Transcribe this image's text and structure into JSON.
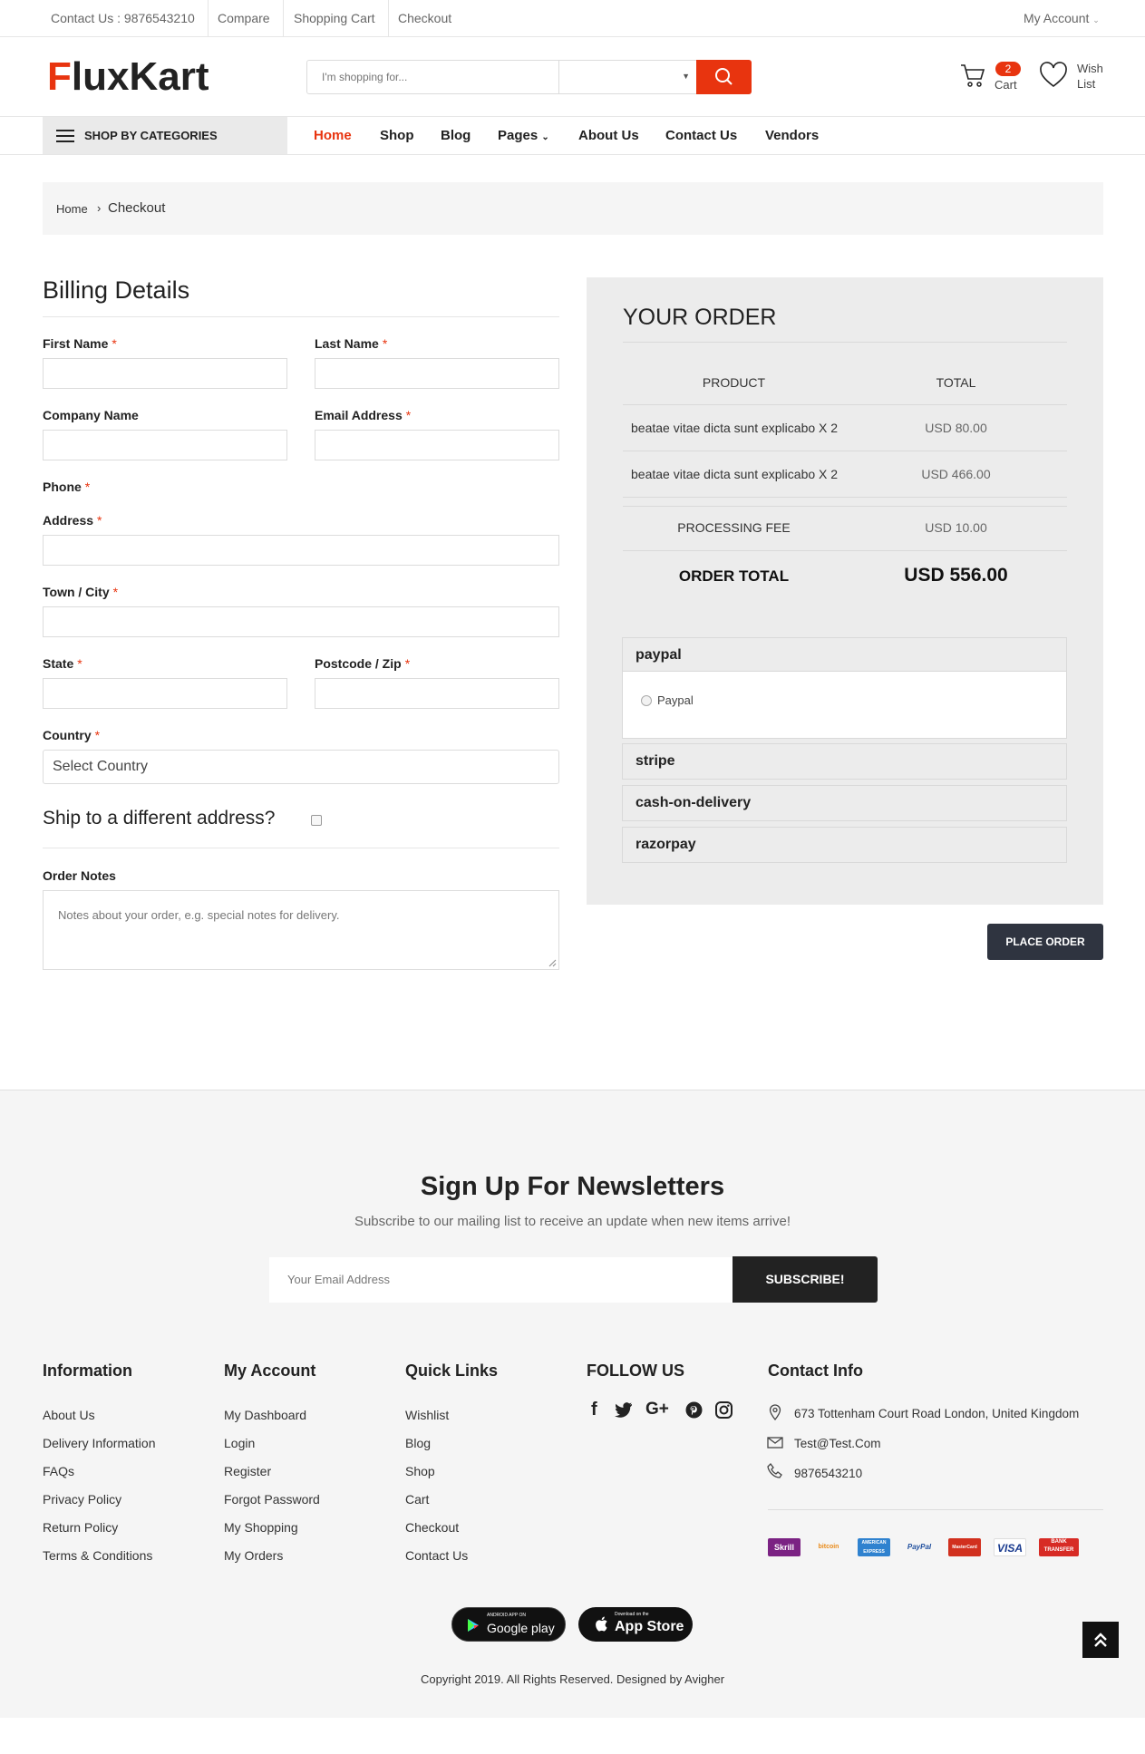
{
  "topbar": {
    "contact": "Contact Us : 9876543210",
    "compare": "Compare",
    "cart": "Shopping Cart",
    "checkout": "Checkout",
    "account": "My Account"
  },
  "header": {
    "logo_a": "F",
    "logo_b": "luxKart",
    "search_placeholder": "I'm shopping for...",
    "cart_count": "2",
    "cart_label": "Cart",
    "wish_label_1": "Wish",
    "wish_label_2": "List"
  },
  "nav": {
    "categories": "SHOP BY CATEGORIES",
    "links": [
      "Home",
      "Shop",
      "Blog",
      "Pages",
      "About Us",
      "Contact Us",
      "Vendors"
    ]
  },
  "breadcrumb": {
    "home": "Home",
    "current": "Checkout"
  },
  "billing": {
    "title": "Billing Details",
    "first_name": "First Name",
    "last_name": "Last Name",
    "company": "Company Name",
    "email": "Email Address",
    "phone": "Phone",
    "address": "Address",
    "town": "Town / City",
    "state": "State",
    "postcode": "Postcode / Zip",
    "country": "Country",
    "country_value": "Select Country",
    "required": "*",
    "ship_different": "Ship to a different address?",
    "order_notes": "Order Notes",
    "notes_placeholder": "Notes about your order, e.g. special notes for delivery."
  },
  "order": {
    "title": "YOUR ORDER",
    "col_product": "PRODUCT",
    "col_total": "TOTAL",
    "items": [
      {
        "name": "beatae vitae dicta sunt explicabo X 2",
        "total": "USD 80.00"
      },
      {
        "name": "beatae vitae dicta sunt explicabo X 2",
        "total": "USD 466.00"
      }
    ],
    "fee_label": "PROCESSING FEE",
    "fee_value": "USD 10.00",
    "total_label": "ORDER TOTAL",
    "total_value": "USD 556.00",
    "payments": [
      {
        "name": "paypal",
        "option": "Paypal"
      },
      {
        "name": "stripe"
      },
      {
        "name": "cash-on-delivery"
      },
      {
        "name": "razorpay"
      }
    ],
    "place_order": "PLACE ORDER"
  },
  "newsletter": {
    "title": "Sign Up For Newsletters",
    "subtitle": "Subscribe to our mailing list to receive an update when new items arrive!",
    "placeholder": "Your Email Address",
    "button": "SUBSCRIBE!"
  },
  "footer": {
    "information": {
      "title": "Information",
      "links": [
        "About Us",
        "Delivery Information",
        "FAQs",
        "Privacy Policy",
        "Return Policy",
        "Terms & Conditions"
      ]
    },
    "account": {
      "title": "My Account",
      "links": [
        "My Dashboard",
        "Login",
        "Register",
        "Forgot Password",
        "My Shopping",
        "My Orders"
      ]
    },
    "quick": {
      "title": "Quick Links",
      "links": [
        "Wishlist",
        "Blog",
        "Shop",
        "Cart",
        "Checkout",
        "Contact Us"
      ]
    },
    "follow": {
      "title": "FOLLOW US",
      "icons": [
        "facebook-icon",
        "twitter-icon",
        "google-plus-icon",
        "pinterest-icon",
        "instagram-icon"
      ]
    },
    "contact": {
      "title": "Contact Info",
      "address": "673 Tottenham Court Road London, United Kingdom",
      "email": "Test@Test.Com",
      "phone": "9876543210"
    },
    "payment_cards": [
      "Skrill",
      "bitcoin",
      "AMERICAN EXPRESS",
      "PayPal",
      "MasterCard",
      "VISA",
      "BANK TRANSFER"
    ],
    "apps": {
      "google_top": "ANDROID APP ON",
      "google_main": "Google play",
      "apple_top": "Download on the",
      "apple_main": "App Store"
    },
    "copyright": "Copyright 2019. All Rights Reserved. Designed by Avigher"
  },
  "colors": {
    "accent": "#e8340f",
    "dark": "#2f3440"
  }
}
